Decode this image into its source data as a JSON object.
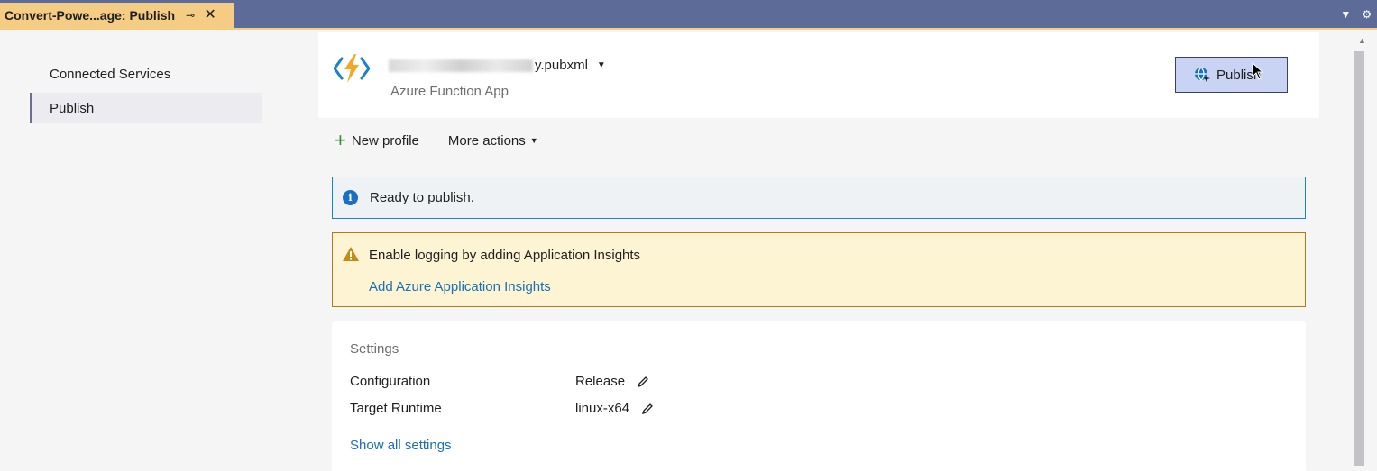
{
  "tab": {
    "title": "Convert-Powe...age: Publish",
    "pin_glyph": "⊸",
    "close_glyph": "✕",
    "right_icons": [
      "chevron-down-icon",
      "gear-icon"
    ]
  },
  "leftnav": {
    "items": [
      {
        "label": "Connected Services",
        "active": false
      },
      {
        "label": "Publish",
        "active": true
      }
    ]
  },
  "profile": {
    "name_suffix": "y.pubxml",
    "type": "Azure Function App",
    "publish_label": "Publish"
  },
  "actions": {
    "new_profile": "New profile",
    "more_actions": "More actions"
  },
  "info": {
    "message": "Ready to publish.",
    "icon_glyph": "i"
  },
  "warning": {
    "message": "Enable logging by adding Application Insights",
    "link": "Add Azure Application Insights"
  },
  "settings": {
    "title": "Settings",
    "rows": [
      {
        "label": "Configuration",
        "value": "Release"
      },
      {
        "label": "Target Runtime",
        "value": "linux-x64"
      }
    ],
    "show_all": "Show all settings"
  },
  "colors": {
    "tabstrip": "#5d6b99",
    "active_tab": "#f5cc84",
    "info_border": "#1a82c5",
    "warning_bg": "#fdf4d4",
    "link": "#1a6fb5"
  }
}
